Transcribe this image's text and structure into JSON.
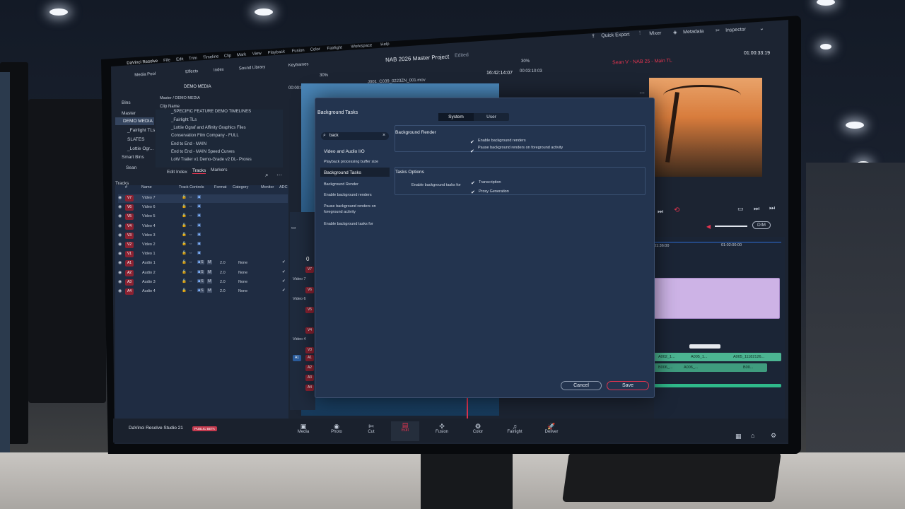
{
  "app": {
    "name": "DaVinci Resolve",
    "project_title": "NAB 2026 Master Project",
    "project_status": "Edited",
    "brand_footer": "DaVinci Resolve Studio 21",
    "beta_badge": "PUBLIC BETA"
  },
  "menubar": [
    "DaVinci Resolve",
    "File",
    "Edit",
    "Trim",
    "Timeline",
    "Clip",
    "Mark",
    "View",
    "Playback",
    "Fusion",
    "Color",
    "Fairlight",
    "Workspace",
    "Help"
  ],
  "toolbar": {
    "media_pool": "Media Pool",
    "effects": "Effects",
    "index": "Index",
    "sound_library": "Sound Library",
    "keyframes": "Keyframes",
    "quick_export": "Quick Export",
    "mixer": "Mixer",
    "metadata": "Metadata",
    "inspector": "Inspector"
  },
  "viewer": {
    "zoom_left": "30%",
    "clip_name": "J001_C039_0223ZN_001.mov",
    "timecode_source": "16:42:14:07",
    "timecode_duration": "00:03:10:03",
    "zoom_right": "30%",
    "timeline_name": "Sean V - NAB 25 - Main TL",
    "timecode_record": "01:00:33:19",
    "timecode_small": "00:00:01:23",
    "dim_label": "DIM"
  },
  "bins": {
    "header": "Bins",
    "breadcrumb": "Master / DEMO MEDIA",
    "folder_label": "DEMO MEDIA",
    "items": [
      "Master",
      "DEMO MEDIA",
      "_Fairlight TLs",
      "SLATES",
      "_Lottie Ogr..."
    ],
    "smart_bins": "Smart Bins",
    "user_bin": "Sean"
  },
  "clips": {
    "column": "Clip Name",
    "items": [
      "_SPECIFIC FEATURE DEMO TIMELINES",
      "_Fairlight TLs",
      "_Lottie Ograf and Affinity Graphics Files",
      "Conservation Film Company - FULL",
      "End to End - MAIN",
      "End to End - MAIN Speed Curves",
      "LoW Trailer v1 Demo-Grade v2 DL- Prores"
    ]
  },
  "index_tabs": [
    "Edit Index",
    "Tracks",
    "Markers"
  ],
  "tracks_panel": {
    "title": "Tracks",
    "columns": [
      "#",
      "Name",
      "Track Controls",
      "Format",
      "Category",
      "Monitor",
      "ADC"
    ],
    "rows": [
      {
        "id": "V7",
        "name": "Video 7",
        "format": "",
        "category": ""
      },
      {
        "id": "V6",
        "name": "Video 6",
        "format": "",
        "category": ""
      },
      {
        "id": "V5",
        "name": "Video 5",
        "format": "",
        "category": ""
      },
      {
        "id": "V4",
        "name": "Video 4",
        "format": "",
        "category": ""
      },
      {
        "id": "V3",
        "name": "Video 3",
        "format": "",
        "category": ""
      },
      {
        "id": "V2",
        "name": "Video 2",
        "format": "",
        "category": ""
      },
      {
        "id": "V1",
        "name": "Video 1",
        "format": "",
        "category": ""
      },
      {
        "id": "A1",
        "name": "Audio 1",
        "format": "2.0",
        "category": "None"
      },
      {
        "id": "A2",
        "name": "Audio 2",
        "format": "2.0",
        "category": "None"
      },
      {
        "id": "A3",
        "name": "Audio 3",
        "format": "2.0",
        "category": "None"
      },
      {
        "id": "A4",
        "name": "Audio 4",
        "format": "2.0",
        "category": "None"
      }
    ]
  },
  "timeline": {
    "track_labels": [
      "V7",
      "Video 7",
      "V6",
      "Video 6",
      "V5",
      "V4",
      "Video 4",
      "V3",
      "A1",
      "A2",
      "A3",
      "A4"
    ],
    "ruler": [
      "01:36:00",
      "01:02:00:00"
    ],
    "clips": [
      "A002_1...",
      "A005_1...",
      "A005_11182126...",
      "B006_...",
      "A006_...",
      "B00..."
    ]
  },
  "dialog": {
    "title": "Background Tasks",
    "tabs": [
      "System",
      "User"
    ],
    "search_value": "back",
    "nav": [
      "Video and Audio I/O",
      "Playback processing buffer size",
      "Background Tasks",
      "Background Render",
      "Enable background renders",
      "Pause background renders on foreground activity",
      "Enable background tasks for"
    ],
    "section_render": "Background Render",
    "opt_enable": "Enable background renders",
    "opt_pause": "Pause background renders on foreground activity",
    "section_tasks": "Tasks Options",
    "tasks_label": "Enable background tasks for",
    "opt_transcription": "Transcription",
    "opt_proxy": "Proxy Generation",
    "cancel": "Cancel",
    "save": "Save"
  },
  "pages": [
    "Media",
    "Photo",
    "Cut",
    "Edit",
    "Fusion",
    "Color",
    "Fairlight",
    "Deliver"
  ],
  "active_page": "Edit",
  "colors": {
    "accent_red": "#e2344f",
    "dialog_bg": "#23344f",
    "track_green": "#2fb98a",
    "clip_purple": "#cdb3e6"
  }
}
